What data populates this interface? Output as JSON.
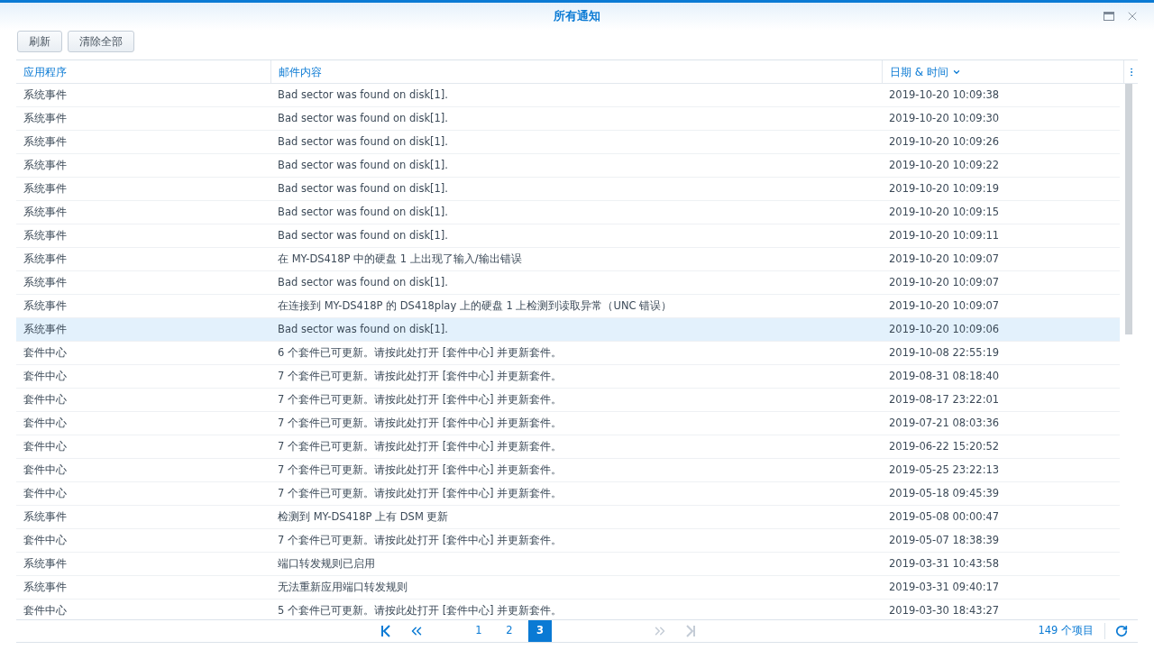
{
  "window": {
    "title": "所有通知"
  },
  "toolbar": {
    "buttons": [
      "刷新",
      "清除全部"
    ]
  },
  "table": {
    "columns": [
      {
        "label": "应用程序",
        "sorted": false
      },
      {
        "label": "邮件内容",
        "sorted": false
      },
      {
        "label": "日期 & 时间",
        "sorted": true
      }
    ],
    "rows": [
      {
        "app": "系统事件",
        "message": "Bad sector was found on disk[1].",
        "time": "2019-10-20 10:09:38",
        "selected": false
      },
      {
        "app": "系统事件",
        "message": "Bad sector was found on disk[1].",
        "time": "2019-10-20 10:09:30",
        "selected": false
      },
      {
        "app": "系统事件",
        "message": "Bad sector was found on disk[1].",
        "time": "2019-10-20 10:09:26",
        "selected": false
      },
      {
        "app": "系统事件",
        "message": "Bad sector was found on disk[1].",
        "time": "2019-10-20 10:09:22",
        "selected": false
      },
      {
        "app": "系统事件",
        "message": "Bad sector was found on disk[1].",
        "time": "2019-10-20 10:09:19",
        "selected": false
      },
      {
        "app": "系统事件",
        "message": "Bad sector was found on disk[1].",
        "time": "2019-10-20 10:09:15",
        "selected": false
      },
      {
        "app": "系统事件",
        "message": "Bad sector was found on disk[1].",
        "time": "2019-10-20 10:09:11",
        "selected": false
      },
      {
        "app": "系统事件",
        "message": "在 MY-DS418P 中的硬盘 1 上出现了输入/输出错误",
        "time": "2019-10-20 10:09:07",
        "selected": false
      },
      {
        "app": "系统事件",
        "message": "Bad sector was found on disk[1].",
        "time": "2019-10-20 10:09:07",
        "selected": false
      },
      {
        "app": "系统事件",
        "message": "在连接到 MY-DS418P 的 DS418play 上的硬盘 1 上检测到读取异常（UNC 错误）",
        "time": "2019-10-20 10:09:07",
        "selected": false
      },
      {
        "app": "系统事件",
        "message": "Bad sector was found on disk[1].",
        "time": "2019-10-20 10:09:06",
        "selected": true
      },
      {
        "app": "套件中心",
        "message": "6 个套件已可更新。请按此处打开 [套件中心] 并更新套件。",
        "time": "2019-10-08 22:55:19",
        "selected": false
      },
      {
        "app": "套件中心",
        "message": "7 个套件已可更新。请按此处打开 [套件中心] 并更新套件。",
        "time": "2019-08-31 08:18:40",
        "selected": false
      },
      {
        "app": "套件中心",
        "message": "7 个套件已可更新。请按此处打开 [套件中心] 并更新套件。",
        "time": "2019-08-17 23:22:01",
        "selected": false
      },
      {
        "app": "套件中心",
        "message": "7 个套件已可更新。请按此处打开 [套件中心] 并更新套件。",
        "time": "2019-07-21 08:03:36",
        "selected": false
      },
      {
        "app": "套件中心",
        "message": "7 个套件已可更新。请按此处打开 [套件中心] 并更新套件。",
        "time": "2019-06-22 15:20:52",
        "selected": false
      },
      {
        "app": "套件中心",
        "message": "7 个套件已可更新。请按此处打开 [套件中心] 并更新套件。",
        "time": "2019-05-25 23:22:13",
        "selected": false
      },
      {
        "app": "套件中心",
        "message": "7 个套件已可更新。请按此处打开 [套件中心] 并更新套件。",
        "time": "2019-05-18 09:45:39",
        "selected": false
      },
      {
        "app": "系统事件",
        "message": "检测到 MY-DS418P 上有 DSM 更新",
        "time": "2019-05-08 00:00:47",
        "selected": false
      },
      {
        "app": "套件中心",
        "message": "7 个套件已可更新。请按此处打开 [套件中心] 并更新套件。",
        "time": "2019-05-07 18:38:39",
        "selected": false
      },
      {
        "app": "系统事件",
        "message": "端口转发规则已启用",
        "time": "2019-03-31 10:43:58",
        "selected": false
      },
      {
        "app": "系统事件",
        "message": "无法重新应用端口转发规则",
        "time": "2019-03-31 09:40:17",
        "selected": false
      },
      {
        "app": "套件中心",
        "message": "5 个套件已可更新。请按此处打开 [套件中心] 并更新套件。",
        "time": "2019-03-30 18:43:27",
        "selected": false
      }
    ]
  },
  "pager": {
    "first_disabled": false,
    "prev_disabled": false,
    "next_disabled": true,
    "last_disabled": true,
    "pages": [
      {
        "label": "1",
        "selected": false
      },
      {
        "label": "2",
        "selected": false
      },
      {
        "label": "3",
        "selected": true
      }
    ],
    "count": "149 个项目"
  }
}
